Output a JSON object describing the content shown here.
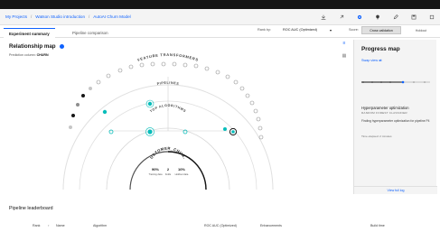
{
  "breadcrumbs": [
    "My Projects",
    "Watson Studio introduction",
    "AutoAI Churn Model"
  ],
  "tabs": [
    {
      "label": "Experiment summary",
      "active": true
    },
    {
      "label": "Pipeline comparison",
      "active": false
    }
  ],
  "rank": {
    "label": "Rank by:",
    "value": "ROC AUC (Optimized)"
  },
  "score": {
    "label": "Score:",
    "cross_validation": "Cross validation",
    "holdout": "Holdout"
  },
  "map": {
    "title": "Relationship map",
    "prediction_label": "Prediction column:",
    "prediction_value": "CHURN",
    "ring_labels": {
      "outer": "FEATURE TRANSFORMERS",
      "middle": "PIPELINES",
      "inner": "TOP ALGORITHMS",
      "center": "CUSTOMER_CHUR..."
    },
    "center_stats": [
      {
        "value": "90%",
        "label": "Training data"
      },
      {
        "value": "2",
        "label": "Folds"
      },
      {
        "value": "10%",
        "label": "Holdout data"
      }
    ]
  },
  "progress": {
    "title": "Progress map",
    "swap": "Swap view",
    "hpo_title": "Hyperparameter optimization",
    "hpo_sub": "RANDOM FOREST CLASSIFIER",
    "hpo_desc": "Finding hyperparameter optimization for pipeline P4",
    "time": "Time elapsed: 2 minutes",
    "view_log": "View full log"
  },
  "leaderboard": {
    "title": "Pipeline leaderboard",
    "columns": [
      "Rank",
      "Name",
      "Algorithm",
      "ROC AUC (Optimized)",
      "Enhancements",
      "Build time"
    ]
  },
  "colors": {
    "accent": "#0f62fe",
    "teal": "#08bdba",
    "dark": "#161616"
  },
  "icons": [
    "download-icon",
    "share-icon",
    "settings-icon",
    "notification-icon",
    "edit-icon",
    "save-icon",
    "stop-icon"
  ]
}
